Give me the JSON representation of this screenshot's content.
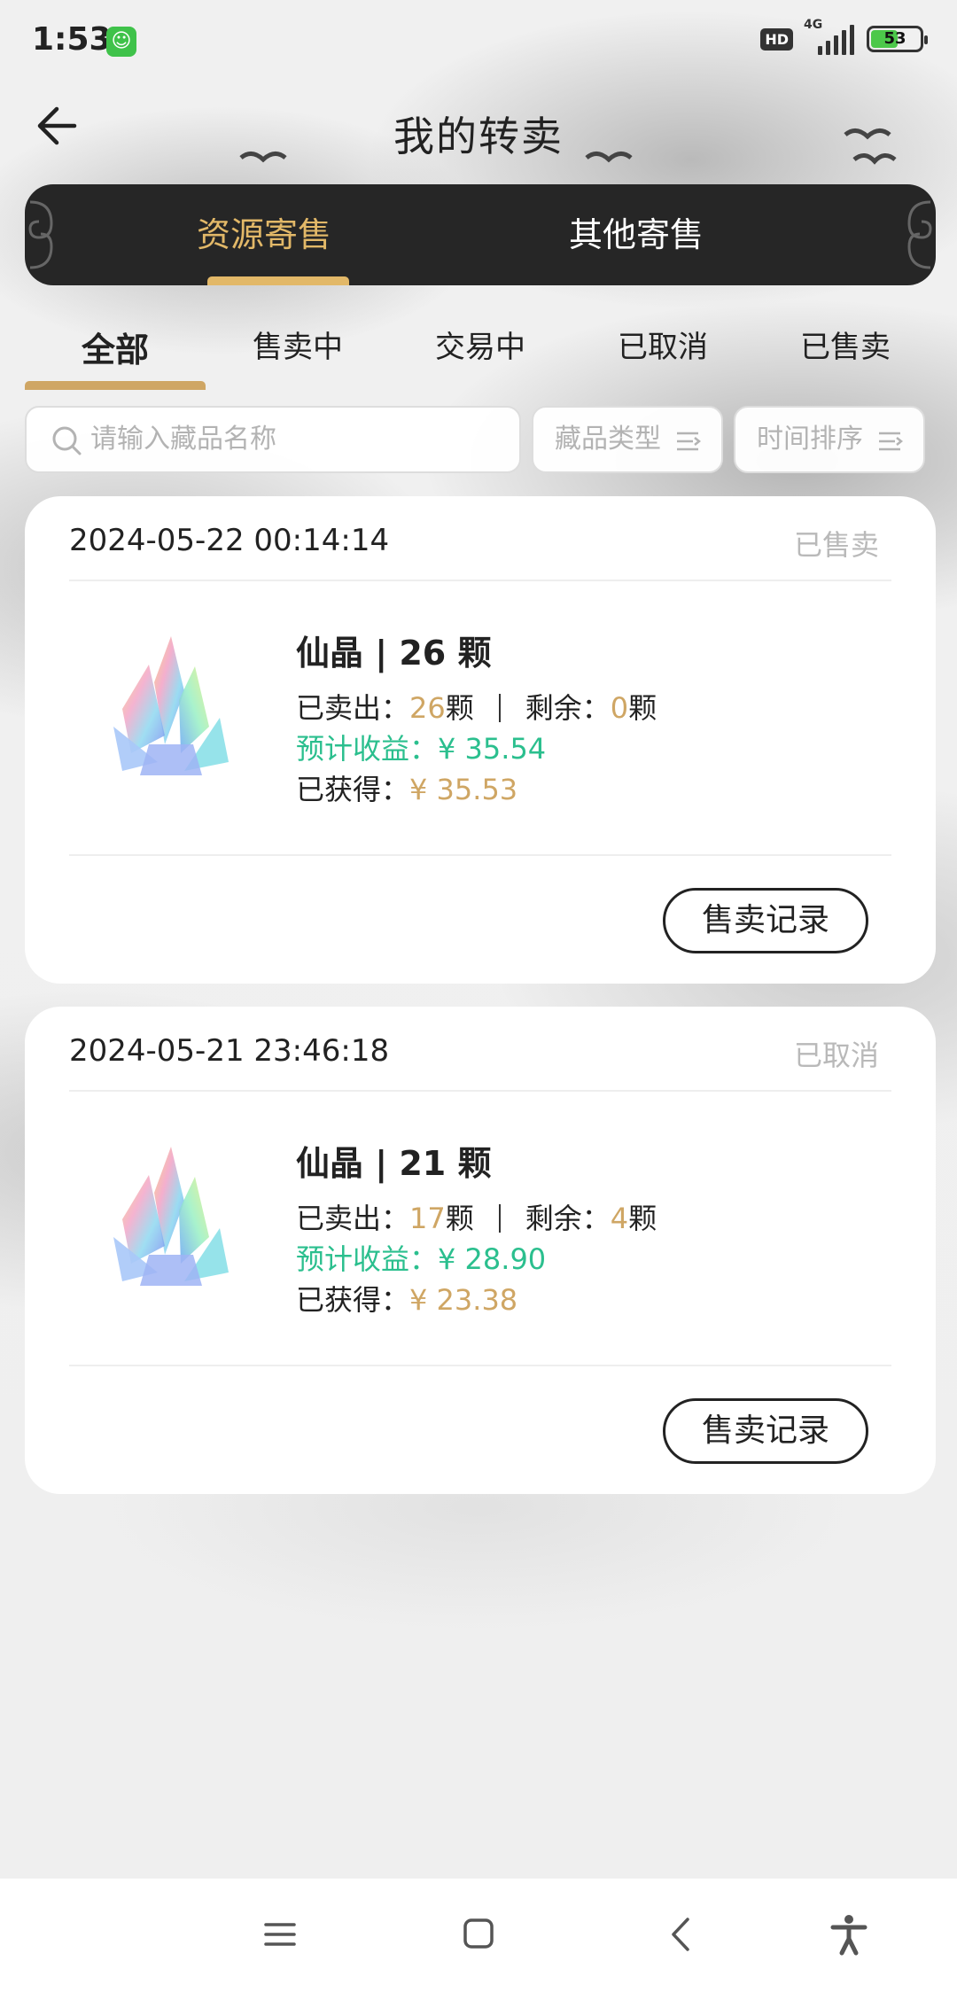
{
  "status_bar": {
    "time": "1:53",
    "hd": "HD",
    "network": "4G",
    "battery": "53"
  },
  "header": {
    "title": "我的转卖"
  },
  "top_tabs": [
    {
      "label": "资源寄售",
      "active": true
    },
    {
      "label": "其他寄售",
      "active": false
    }
  ],
  "filter_tabs": [
    {
      "label": "全部",
      "active": true
    },
    {
      "label": "售卖中",
      "active": false
    },
    {
      "label": "交易中",
      "active": false
    },
    {
      "label": "已取消",
      "active": false
    },
    {
      "label": "已售卖",
      "active": false
    }
  ],
  "search": {
    "placeholder": "请输入藏品名称"
  },
  "filters": {
    "type_label": "藏品类型",
    "time_label": "时间排序"
  },
  "labels": {
    "sold": "已卖出：",
    "remaining": "剩余：",
    "unit": "颗",
    "expected": "预计收益：",
    "obtained": "已获得：",
    "record_button": "售卖记录"
  },
  "cards": [
    {
      "date": "2024-05-22 00:14:14",
      "status": "已售卖",
      "title": "仙晶 | 26 颗",
      "sold": "26",
      "remaining": "0",
      "expected": "¥ 35.54",
      "obtained": "¥ 35.53"
    },
    {
      "date": "2024-05-21 23:46:18",
      "status": "已取消",
      "title": "仙晶 | 21 颗",
      "sold": "17",
      "remaining": "4",
      "expected": "¥ 28.90",
      "obtained": "¥ 23.38"
    }
  ],
  "colors": {
    "accent_gold": "#cfa664",
    "tab_gold": "#e2b868",
    "green": "#2bbf8e",
    "dark_bar": "#262626"
  },
  "icons": [
    "back-arrow-icon",
    "search-icon",
    "sort-icon",
    "menu-icon",
    "home-icon",
    "back-icon",
    "accessibility-icon"
  ]
}
